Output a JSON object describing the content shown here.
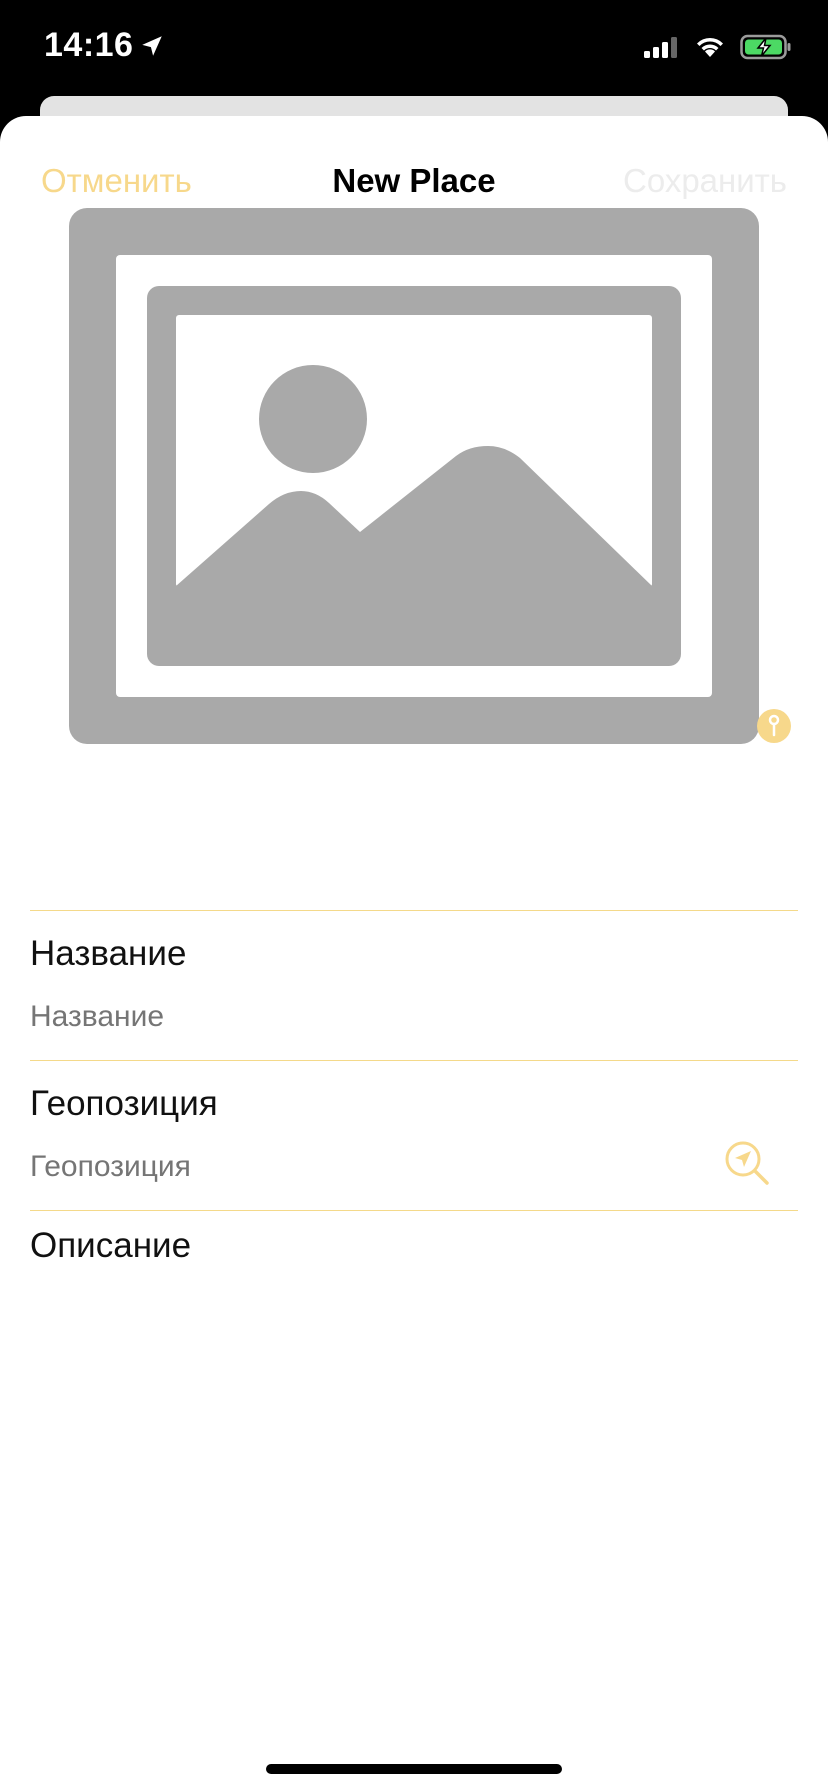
{
  "status_bar": {
    "time": "14:16",
    "icons": [
      "location-arrow-icon",
      "cellular-signal-icon",
      "wifi-icon",
      "battery-charging-icon"
    ]
  },
  "nav": {
    "cancel_label": "Отменить",
    "title": "New Place",
    "save_label": "Сохранить"
  },
  "image": {
    "placeholder_icon": "photo-placeholder-icon",
    "edit_icon": "info-pin-icon"
  },
  "fields": {
    "name": {
      "label": "Название",
      "placeholder": "Название",
      "value": ""
    },
    "location": {
      "label": "Геопозиция",
      "placeholder": "Геопозиция",
      "value": "",
      "action_icon": "location-search-icon"
    },
    "description": {
      "label": "Описание",
      "value": ""
    }
  },
  "colors": {
    "accent": "#f7d88b",
    "disabled": "#ececec",
    "placeholder_gray": "#a9a9a9",
    "separator": "#f4d98a"
  }
}
